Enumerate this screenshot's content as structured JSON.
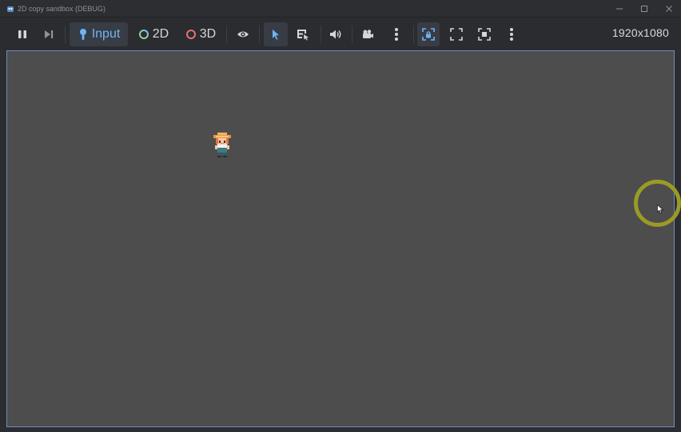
{
  "window": {
    "title": "2D copy sandbox (DEBUG)",
    "controls": [
      "minimize",
      "maximize",
      "close"
    ]
  },
  "toolbar": {
    "pause_icon": "pause-icon",
    "step_icon": "next-frame-icon",
    "input_label": "Input",
    "mode_2d_label": "2D",
    "mode_3d_label": "3D",
    "resolution": "1920x1080"
  },
  "colors": {
    "accent": "#6fb4f3",
    "viewport_bg": "#4d4d4d",
    "cursor_highlight": "#9b9a26"
  }
}
